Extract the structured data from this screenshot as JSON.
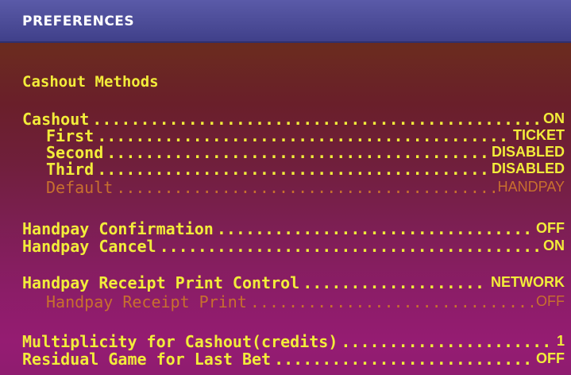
{
  "header": {
    "title": "PREFERENCES"
  },
  "section": {
    "title": "Cashout Methods"
  },
  "rows": [
    {
      "label": "Cashout",
      "value": "ON"
    },
    {
      "label": "First",
      "value": "TICKET"
    },
    {
      "label": "Second",
      "value": "DISABLED"
    },
    {
      "label": "Third",
      "value": "DISABLED"
    },
    {
      "label": "Default",
      "value": "HANDPAY"
    },
    {
      "label": "Handpay Confirmation",
      "value": "OFF"
    },
    {
      "label": "Handpay Cancel",
      "value": "ON"
    },
    {
      "label": "Handpay Receipt Print Control",
      "value": "NETWORK"
    },
    {
      "label": "Handpay Receipt Print",
      "value": "OFF"
    },
    {
      "label": "Multiplicity for Cashout(credits)",
      "value": "1"
    },
    {
      "label": "Residual Game for Last Bet",
      "value": "OFF"
    }
  ],
  "colors": {
    "header_bg": "#4b4b96",
    "text_yellow": "#f2ec3a",
    "text_dim": "#c8702e"
  }
}
